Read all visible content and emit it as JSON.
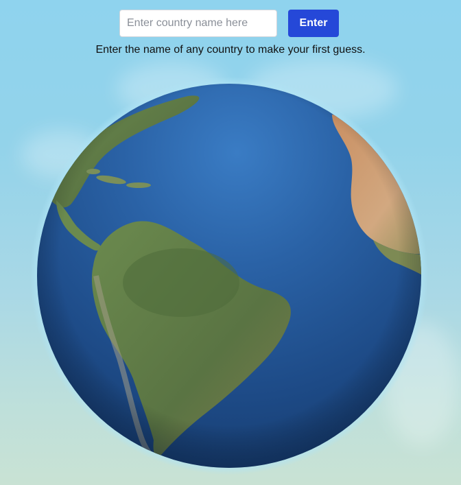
{
  "search": {
    "placeholder": "Enter country name here",
    "value": "",
    "button_label": "Enter"
  },
  "instructions": "Enter the name of any country to make your first guess.",
  "globe": {
    "view": "South America and Atlantic Ocean",
    "colors": {
      "ocean": "#1f4f93",
      "land": "#5e7a45",
      "desert": "#c49a6c",
      "sky": "#8fd3ee"
    }
  },
  "colors": {
    "button": "#2548d8",
    "button_text": "#ffffff"
  }
}
